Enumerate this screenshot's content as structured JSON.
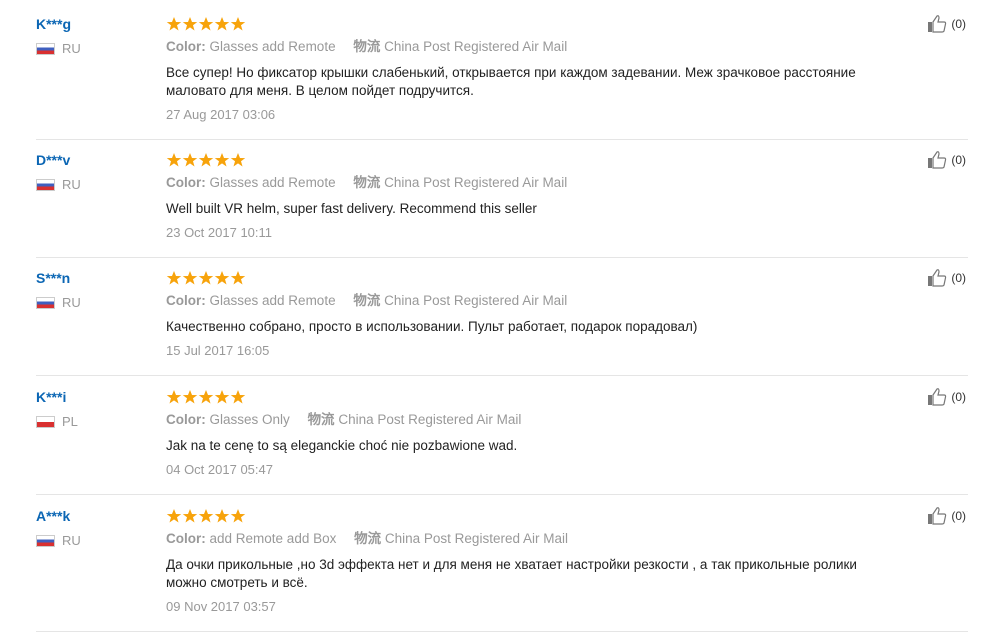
{
  "reviews": [
    {
      "user": "K***g",
      "country": "RU",
      "flag": "ru",
      "rating": 5,
      "color_label": "Color:",
      "color_value": "Glasses add Remote",
      "shipping_label": "物流",
      "shipping_value": "China Post Registered Air Mail",
      "text": "Все супер! Но фиксатор крышки слабенький, открывается при каждом задевании. Меж зрачковое расстояние маловато для меня. В целом пойдет подручится.",
      "date": "27 Aug 2017 03:06",
      "helpful": "(0)"
    },
    {
      "user": "D***v",
      "country": "RU",
      "flag": "ru",
      "rating": 5,
      "color_label": "Color:",
      "color_value": "Glasses add Remote",
      "shipping_label": "物流",
      "shipping_value": "China Post Registered Air Mail",
      "text": "Well built VR helm, super fast delivery. Recommend this seller",
      "date": "23 Oct 2017 10:11",
      "helpful": "(0)"
    },
    {
      "user": "S***n",
      "country": "RU",
      "flag": "ru",
      "rating": 5,
      "color_label": "Color:",
      "color_value": "Glasses add Remote",
      "shipping_label": "物流",
      "shipping_value": "China Post Registered Air Mail",
      "text": "Качественно собрано, просто в использовании. Пульт работает, подарок порадовал)",
      "date": "15 Jul 2017 16:05",
      "helpful": "(0)"
    },
    {
      "user": "K***i",
      "country": "PL",
      "flag": "pl",
      "rating": 5,
      "color_label": "Color:",
      "color_value": "Glasses Only",
      "shipping_label": "物流",
      "shipping_value": "China Post Registered Air Mail",
      "text": "Jak na te cenę to są eleganckie choć nie pozbawione wad.",
      "date": "04 Oct 2017 05:47",
      "helpful": "(0)"
    },
    {
      "user": "A***k",
      "country": "RU",
      "flag": "ru",
      "rating": 5,
      "color_label": "Color:",
      "color_value": "add Remote add Box",
      "shipping_label": "物流",
      "shipping_value": "China Post Registered Air Mail",
      "text": "Да очки прикольные ,но 3d эффекта нет и для меня не хватает настройки резкости , а так прикольные ролики можно смотреть и всё.",
      "date": "09 Nov 2017 03:57",
      "helpful": "(0)"
    }
  ],
  "colors": {
    "user": "#0b66b4",
    "star": "#f7a30b",
    "muted": "#999999"
  },
  "icons": {
    "star": "star-icon",
    "thumb": "thumbs-up-icon"
  }
}
